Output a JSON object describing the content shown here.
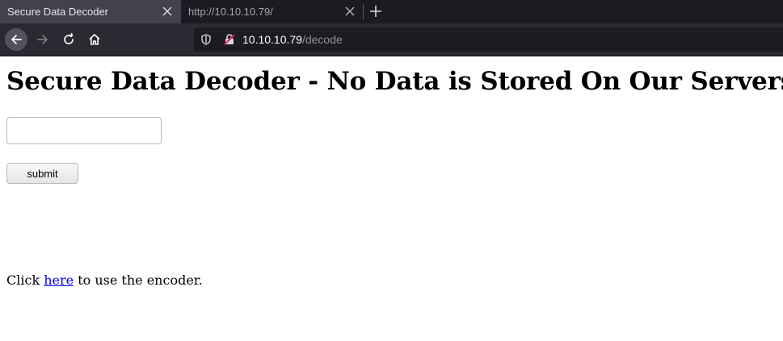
{
  "browser": {
    "tabs": [
      {
        "title": "Secure Data Decoder",
        "active": true
      },
      {
        "title": "http://10.10.10.79/",
        "active": false
      }
    ],
    "url": {
      "host": "10.10.10.79",
      "path": "/decode"
    }
  },
  "page": {
    "heading": "Secure Data Decoder - No Data is Stored On Our Servers",
    "input": {
      "value": "",
      "placeholder": ""
    },
    "submit_label": "submit",
    "footer": {
      "prefix": "Click ",
      "link_text": "here",
      "suffix": " to use the encoder."
    }
  },
  "colors": {
    "link": "#0000ee",
    "tab_active_bg": "#42414d",
    "toolbar_bg": "#2b2a33",
    "urlbar_bg": "#1c1b22"
  }
}
